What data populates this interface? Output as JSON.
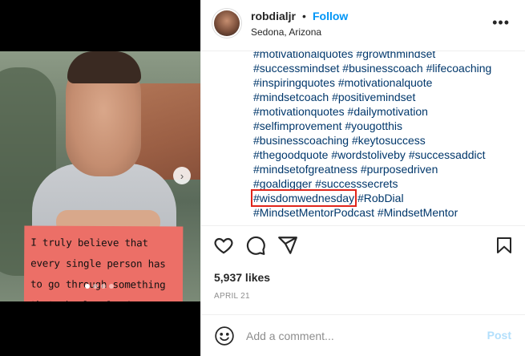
{
  "post": {
    "username": "robdialjr",
    "separator": "•",
    "follow_label": "Follow",
    "location": "Sedona, Arizona",
    "more_icon": "more-horizontal-icon",
    "image_text": "I truly believe that every single person has to go through something that absolutely destroys them so they can figure out who they really are.",
    "caption_lines": [
      [
        "#motivationalquotes",
        "#growthmindset"
      ],
      [
        "#successmindset",
        "#businesscoach",
        "#lifecoaching"
      ],
      [
        "#inspiringquotes",
        "#motivationalquote"
      ],
      [
        "#mindsetcoach",
        "#positivemindset"
      ],
      [
        "#motivationquotes",
        "#dailymotivation"
      ],
      [
        "#selfimprovement",
        "#yougotthis"
      ],
      [
        "#businesscoaching",
        "#keytosuccess"
      ],
      [
        "#thegoodquote",
        "#wordstoliveby",
        "#successaddict"
      ],
      [
        "#mindsetofgreatness",
        "#purposedriven"
      ],
      [
        "#goaldigger",
        "#successsecrets"
      ],
      [
        "#wisdomwednesday",
        "#RobDial"
      ],
      [
        "#MindsetMentorPodcast",
        "#MindsetMentor"
      ]
    ],
    "highlighted_tag": "#wisdomwednesday",
    "likes": "5,937 likes",
    "date": "APRIL 21",
    "comment_placeholder": "Add a comment...",
    "post_label": "Post"
  },
  "colors": {
    "link": "#00376b",
    "follow_blue": "#0095f6",
    "post_disabled": "#b2dffc",
    "highlight_box": "#e0251b",
    "card_red": "#ec6f67"
  },
  "carousel": {
    "slides": 4,
    "active_index": 0
  }
}
